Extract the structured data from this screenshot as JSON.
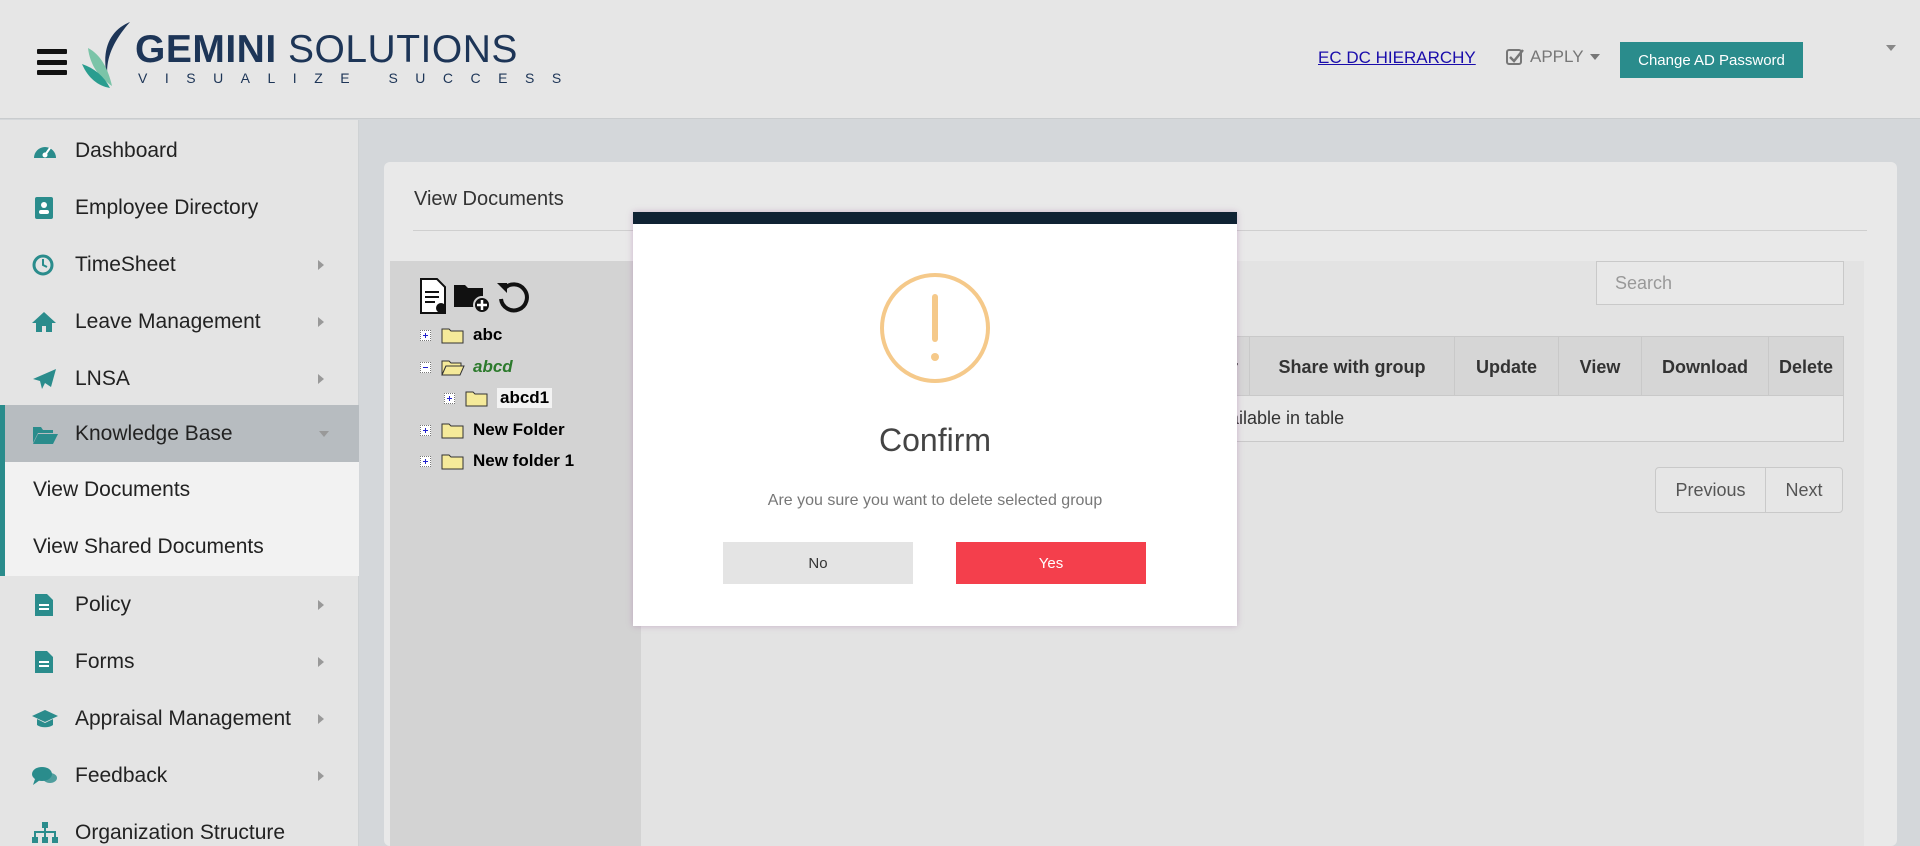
{
  "header": {
    "logo_word1": "GEMINI",
    "logo_word2": "SOLUTIONS",
    "logo_tagline": "VISUALIZE SUCCESS",
    "hierarchy_link": "EC DC HIERARCHY",
    "apply_label": "APPLY",
    "change_password_button": "Change AD Password",
    "accent_color": "#2a8c8c"
  },
  "sidebar": {
    "items": [
      {
        "label": "Dashboard",
        "icon": "dashboard-icon",
        "has_submenu": false
      },
      {
        "label": "Employee Directory",
        "icon": "address-book-icon",
        "has_submenu": false
      },
      {
        "label": "TimeSheet",
        "icon": "clock-icon",
        "has_submenu": true
      },
      {
        "label": "Leave Management",
        "icon": "home-icon",
        "has_submenu": true
      },
      {
        "label": "LNSA",
        "icon": "paper-plane-icon",
        "has_submenu": true
      },
      {
        "label": "Knowledge Base",
        "icon": "folder-open-icon",
        "has_submenu": true,
        "expanded": true
      },
      {
        "label": "Policy",
        "icon": "file-text-icon",
        "has_submenu": true
      },
      {
        "label": "Forms",
        "icon": "file-text-icon",
        "has_submenu": true
      },
      {
        "label": "Appraisal Management",
        "icon": "graduation-cap-icon",
        "has_submenu": true
      },
      {
        "label": "Feedback",
        "icon": "comments-icon",
        "has_submenu": true
      },
      {
        "label": "Organization Structure",
        "icon": "sitemap-icon",
        "has_submenu": false
      }
    ],
    "subitems": [
      {
        "label": "View Documents"
      },
      {
        "label": "View Shared Documents"
      }
    ]
  },
  "main": {
    "title": "View Documents",
    "tree": [
      {
        "name": "abc",
        "expanded": false
      },
      {
        "name": "abcd",
        "expanded": true,
        "selected": true
      },
      {
        "name": "abcd1",
        "expanded": false
      },
      {
        "name": "New Folder",
        "expanded": false
      },
      {
        "name": "New folder 1",
        "expanded": false
      }
    ],
    "search_placeholder": "Search",
    "table": {
      "columns": [
        "r",
        "Share with group",
        "Update",
        "View",
        "Download",
        "Delete"
      ],
      "empty_text": "vailable in table"
    },
    "pager": {
      "previous": "Previous",
      "next": "Next"
    }
  },
  "modal": {
    "title": "Confirm",
    "message": "Are you sure you want to delete selected group",
    "no_label": "No",
    "yes_label": "Yes",
    "warn_color": "#f5c98a",
    "yes_color": "#f43f4c"
  }
}
